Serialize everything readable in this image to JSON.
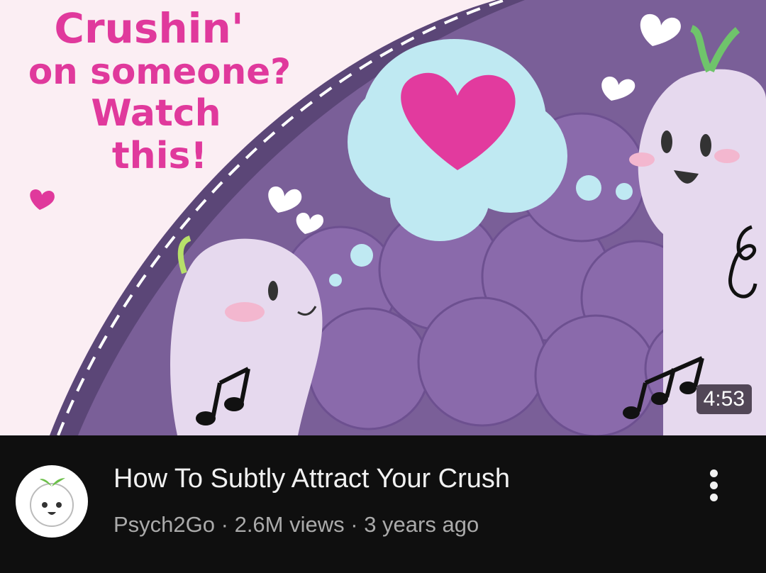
{
  "thumbnail": {
    "text_lines": [
      "Crushin'",
      "on someone?",
      "Watch",
      "this!"
    ],
    "duration": "4:53"
  },
  "video": {
    "title": "How To Subtly Attract Your Crush",
    "channel": "Psych2Go",
    "separator": " · ",
    "views": "2.6M views",
    "age": "3 years ago"
  },
  "icons": {
    "more": "kebab-menu-icon",
    "avatar": "channel-avatar"
  },
  "colors": {
    "background": "#0f0f0f",
    "title": "#f1f1f1",
    "meta": "#aaaaaa",
    "thumb_text": "#e0399c"
  }
}
